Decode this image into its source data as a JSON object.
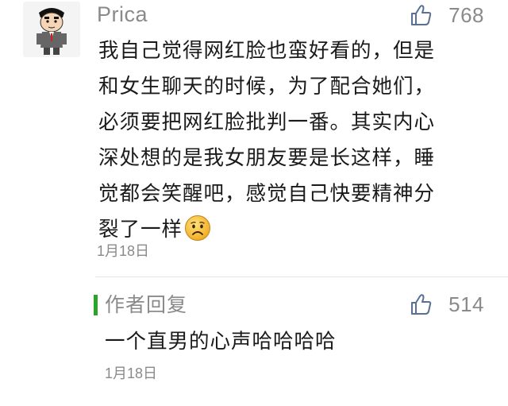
{
  "comment": {
    "username": "Prica",
    "likes": "768",
    "lines": [
      "我自己觉得网红脸也蛮好看的，但是",
      "和女生聊天的时候，为了配合她们，",
      "必须要把网红脸批判一番。其实内心",
      "深处想的是我女朋友要是长这样，睡",
      "觉都会笑醒吧，感觉自己快要精神分",
      "裂了一样"
    ],
    "emoji": "sad-face-icon",
    "date": "1月18日",
    "avatar_icon": "cartoon-avatar-icon"
  },
  "reply": {
    "label": "作者回复",
    "likes": "514",
    "text": "一个直男的心声哈哈哈哈",
    "date": "1月18日",
    "accent_color": "#2aa52a"
  },
  "colors": {
    "text_primary": "#1a1a1a",
    "text_secondary": "#8a8a8a",
    "like_icon": "#5a6f94",
    "divider": "#e3e3e3"
  }
}
